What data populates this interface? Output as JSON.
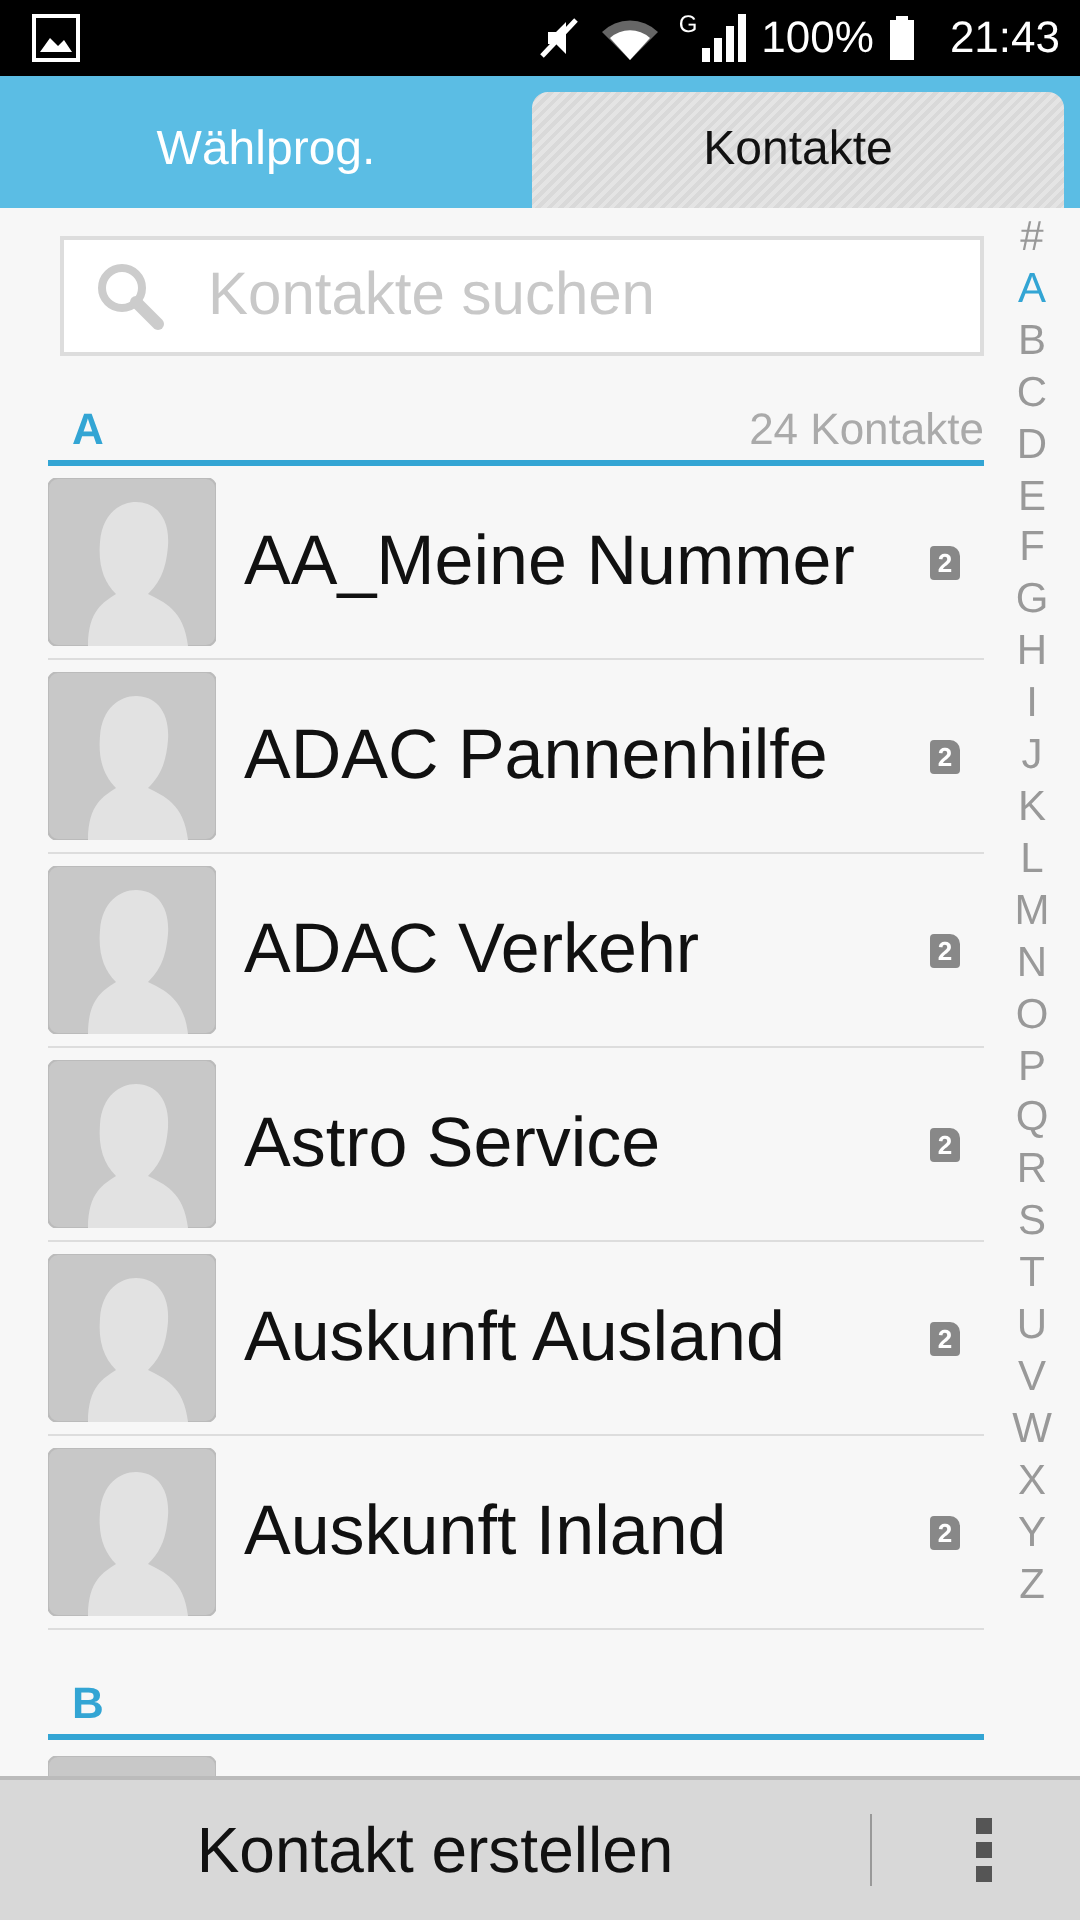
{
  "status_bar": {
    "network": "G",
    "battery": "100%",
    "time": "21:43"
  },
  "tabs": [
    {
      "label": "Wählprog.",
      "selected": false
    },
    {
      "label": "Kontakte",
      "selected": true
    }
  ],
  "search": {
    "placeholder": "Kontakte suchen"
  },
  "sections": [
    {
      "letter": "A",
      "count": "24 Kontakte",
      "contacts": [
        {
          "name": "AA_Meine Nummer",
          "sim": "2"
        },
        {
          "name": "ADAC Pannenhilfe",
          "sim": "2"
        },
        {
          "name": "ADAC Verkehr",
          "sim": "2"
        },
        {
          "name": "Astro Service",
          "sim": "2"
        },
        {
          "name": "Auskunft Ausland",
          "sim": "2"
        },
        {
          "name": "Auskunft Inland",
          "sim": "2"
        }
      ]
    },
    {
      "letter": "B",
      "contacts": [
        {
          "partial": true
        }
      ]
    }
  ],
  "index": [
    {
      "label": "#",
      "selected": false
    },
    {
      "label": "A",
      "selected": true
    },
    {
      "label": "B",
      "selected": false
    },
    {
      "label": "C",
      "selected": false
    },
    {
      "label": "D",
      "selected": false
    },
    {
      "label": "E",
      "selected": false
    },
    {
      "label": "F",
      "selected": false
    },
    {
      "label": "G",
      "selected": false
    },
    {
      "label": "H",
      "selected": false
    },
    {
      "label": "I",
      "selected": false
    },
    {
      "label": "J",
      "selected": false
    },
    {
      "label": "K",
      "selected": false
    },
    {
      "label": "L",
      "selected": false
    },
    {
      "label": "M",
      "selected": false
    },
    {
      "label": "N",
      "selected": false
    },
    {
      "label": "O",
      "selected": false
    },
    {
      "label": "P",
      "selected": false
    },
    {
      "label": "Q",
      "selected": false
    },
    {
      "label": "R",
      "selected": false
    },
    {
      "label": "S",
      "selected": false
    },
    {
      "label": "T",
      "selected": false
    },
    {
      "label": "U",
      "selected": false
    },
    {
      "label": "V",
      "selected": false
    },
    {
      "label": "W",
      "selected": false
    },
    {
      "label": "X",
      "selected": false
    },
    {
      "label": "Y",
      "selected": false
    },
    {
      "label": "Z",
      "selected": false
    }
  ],
  "bottom_bar": {
    "action": "Kontakt erstellen"
  }
}
